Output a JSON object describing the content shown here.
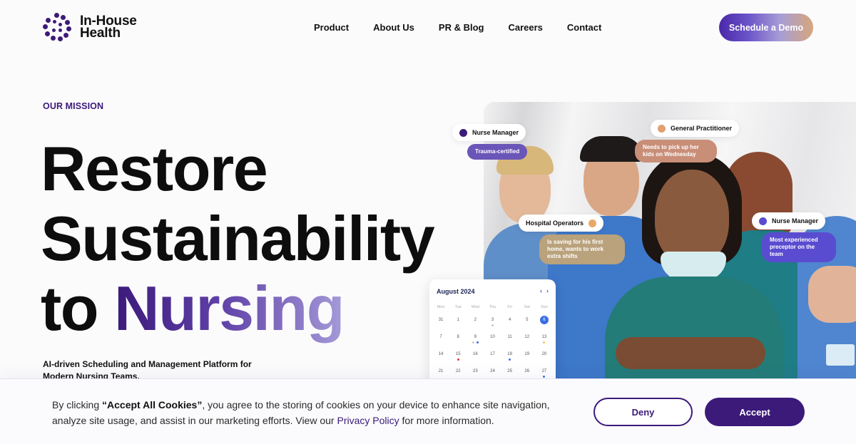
{
  "brand": {
    "name_line1": "In-House",
    "name_line2": "Health",
    "primary_color": "#3b1a7a"
  },
  "nav": {
    "items": [
      {
        "label": "Product"
      },
      {
        "label": "About Us"
      },
      {
        "label": "PR & Blog"
      },
      {
        "label": "Careers"
      },
      {
        "label": "Contact"
      }
    ]
  },
  "header": {
    "cta_label": "Schedule a Demo"
  },
  "hero": {
    "eyebrow": "OUR MISSION",
    "headline_line1": "Restore",
    "headline_line2": "Sustainability",
    "headline_line3_plain": "to ",
    "headline_line3_accent": "Nursing",
    "subtext": "AI-driven Scheduling and Management Platform for Modern Nursing Teams."
  },
  "photo_cards": [
    {
      "role": "Nurse Manager",
      "dot_color": "#3b1a7a",
      "note": "Trauma-certified",
      "note_color": "#6a55b8"
    },
    {
      "role": "General Practitioner",
      "dot_color": "#e0a070",
      "note": "Needs to pick up her kids on Wednesday",
      "note_color": "#c98e78"
    },
    {
      "role": "Hospital Operators",
      "dot_color": "#e8a868",
      "note": "Is saving for his first home, wants to work extra shifts",
      "note_color": "#b9a27c"
    },
    {
      "role": "Nurse Manager",
      "dot_color": "#5a4cd0",
      "note": "Most experienced preceptor on the team",
      "note_color": "#5a4cd0"
    }
  ],
  "calendar": {
    "title": "August 2024",
    "prev_icon": "‹",
    "next_icon": "›",
    "weekdays": [
      "Mon",
      "Tue",
      "Wed",
      "Thu",
      "Fri",
      "Sat",
      "Sun"
    ],
    "selected_day": "6",
    "days": [
      {
        "n": "31",
        "dots": []
      },
      {
        "n": "1",
        "dots": []
      },
      {
        "n": "2",
        "dots": []
      },
      {
        "n": "3",
        "dots": [
          "#c8c8c8"
        ]
      },
      {
        "n": "4",
        "dots": []
      },
      {
        "n": "5",
        "dots": []
      },
      {
        "n": "6",
        "dots": [],
        "selected": true
      },
      {
        "n": "7",
        "dots": []
      },
      {
        "n": "8",
        "dots": []
      },
      {
        "n": "9",
        "dots": [
          "#c8c8c8",
          "#3a6ee8"
        ]
      },
      {
        "n": "10",
        "dots": []
      },
      {
        "n": "11",
        "dots": []
      },
      {
        "n": "12",
        "dots": []
      },
      {
        "n": "13",
        "dots": [
          "#f2c45a"
        ]
      },
      {
        "n": "14",
        "dots": []
      },
      {
        "n": "15",
        "dots": [
          "#d83a3a"
        ]
      },
      {
        "n": "16",
        "dots": []
      },
      {
        "n": "17",
        "dots": []
      },
      {
        "n": "18",
        "dots": [
          "#3a6ee8"
        ]
      },
      {
        "n": "19",
        "dots": []
      },
      {
        "n": "20",
        "dots": []
      },
      {
        "n": "21",
        "dots": []
      },
      {
        "n": "22",
        "dots": []
      },
      {
        "n": "23",
        "dots": []
      },
      {
        "n": "24",
        "dots": []
      },
      {
        "n": "25",
        "dots": []
      },
      {
        "n": "26",
        "dots": []
      },
      {
        "n": "27",
        "dots": [
          "#3a6ee8"
        ]
      }
    ]
  },
  "cookie": {
    "text_before": "By clicking ",
    "text_bold": "“Accept All Cookies”",
    "text_after": ", you agree to the storing of cookies on your device to enhance site navigation, analyze site usage, and assist in our marketing efforts. View our ",
    "link_label": "Privacy Policy",
    "text_end": " for more information.",
    "deny_label": "Deny",
    "accept_label": "Accept"
  }
}
